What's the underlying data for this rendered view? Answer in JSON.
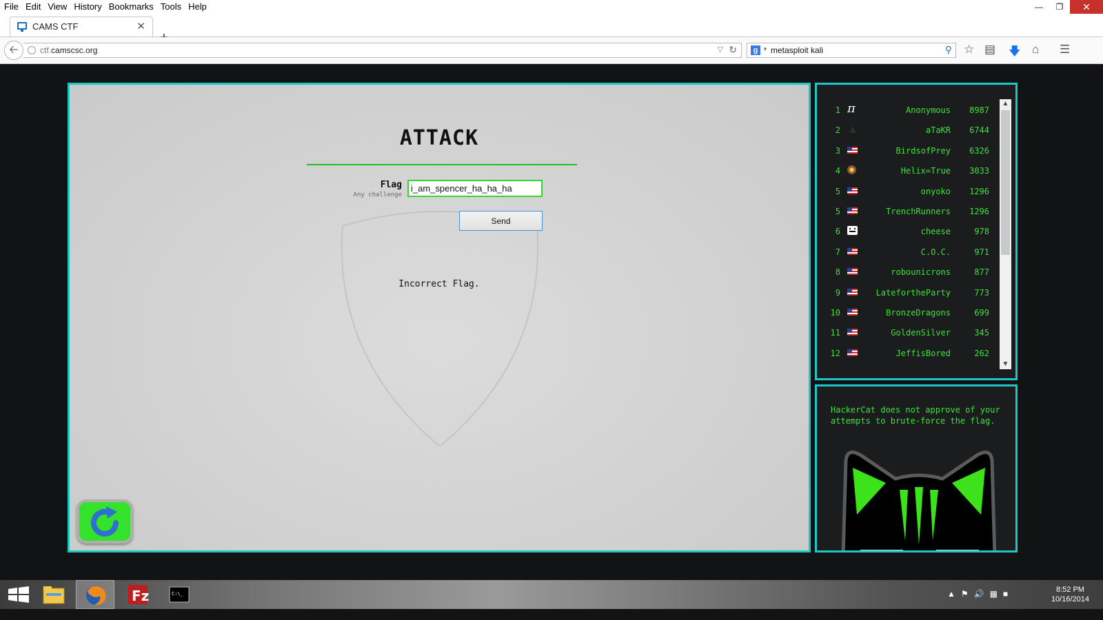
{
  "menubar": {
    "items": [
      "File",
      "Edit",
      "View",
      "History",
      "Bookmarks",
      "Tools",
      "Help"
    ]
  },
  "tab": {
    "title": "CAMS CTF"
  },
  "address": {
    "host": "ctf.camscsc.org"
  },
  "search": {
    "engine_glyph": "g",
    "query": "metasploit kali"
  },
  "attack": {
    "title": "ATTACK",
    "flag_label": "Flag",
    "flag_sublabel": "Any challenge",
    "flag_value": "i_am_spencer_ha_ha_ha",
    "send_label": "Send",
    "result": "Incorrect Flag."
  },
  "scoreboard": {
    "rows": [
      {
        "rank": "1",
        "name": "Anonymous",
        "points": "8987",
        "icon": "pi"
      },
      {
        "rank": "2",
        "name": "aTaKR",
        "points": "6744",
        "icon": "hat"
      },
      {
        "rank": "3",
        "name": "BirdsofPrey",
        "points": "6326",
        "icon": "us"
      },
      {
        "rank": "4",
        "name": "Helix=True",
        "points": "3033",
        "icon": "badge"
      },
      {
        "rank": "5",
        "name": "onyoko",
        "points": "1296",
        "icon": "us"
      },
      {
        "rank": "5",
        "name": "TrenchRunners",
        "points": "1296",
        "icon": "us"
      },
      {
        "rank": "6",
        "name": "cheese",
        "points": "978",
        "icon": "cheese"
      },
      {
        "rank": "7",
        "name": "C.O.C.",
        "points": "971",
        "icon": "us"
      },
      {
        "rank": "8",
        "name": "robounicrons",
        "points": "877",
        "icon": "us"
      },
      {
        "rank": "9",
        "name": "LatefortheParty",
        "points": "773",
        "icon": "us"
      },
      {
        "rank": "10",
        "name": "BronzeDragons",
        "points": "699",
        "icon": "us"
      },
      {
        "rank": "11",
        "name": "GoldenSilver",
        "points": "345",
        "icon": "us"
      },
      {
        "rank": "12",
        "name": "JeffisBored",
        "points": "262",
        "icon": "us"
      }
    ]
  },
  "hackercat": {
    "message": "HackerCat does not approve of your attempts to brute-force the flag."
  },
  "clock": {
    "time": "8:52 PM",
    "date": "10/16/2014"
  },
  "colors": {
    "accent_cyan": "#1cc7c7",
    "terminal_green": "#3fe03a",
    "rule_green": "#1fbf1f"
  },
  "icons": [
    "back-arrow-icon",
    "globe-icon",
    "reload-icon",
    "search-icon",
    "star-icon",
    "reading-list-icon",
    "download-icon",
    "home-icon",
    "menu-icon",
    "refresh-icon",
    "windows-start-icon",
    "file-explorer-icon",
    "firefox-icon",
    "filezilla-icon",
    "terminal-icon"
  ]
}
